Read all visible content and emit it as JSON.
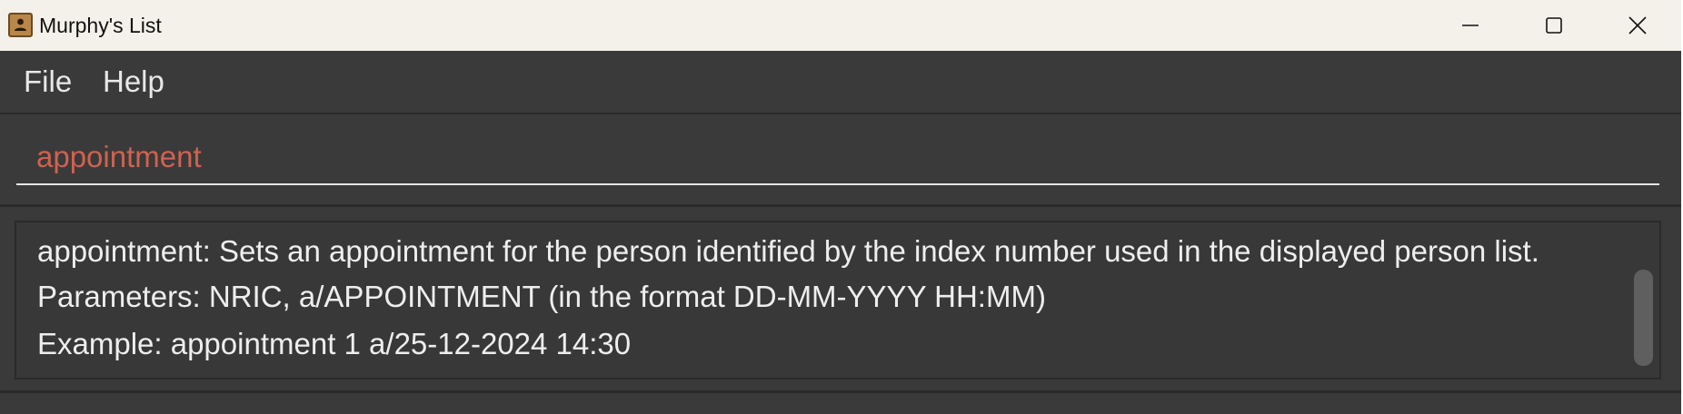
{
  "window": {
    "title": "Murphy's List",
    "icon": "address-book-icon",
    "controls": [
      "minimize-icon",
      "maximize-icon",
      "close-icon"
    ]
  },
  "menubar": {
    "items": [
      {
        "label": "File"
      },
      {
        "label": "Help"
      }
    ]
  },
  "command_box": {
    "value": "appointment",
    "text_color": "#d0624f"
  },
  "result_display": {
    "lines": [
      "appointment: Sets an appointment for the person identified by the index number used in the displayed person list.",
      "Parameters: NRIC, a/APPOINTMENT (in the format DD-MM-YYYY HH:MM)",
      "Example: appointment 1 a/25-12-2024 14:30"
    ]
  },
  "colors": {
    "background": "#3a3a3a",
    "title_bar": "#f4f1ea",
    "text": "#eeeeee"
  }
}
